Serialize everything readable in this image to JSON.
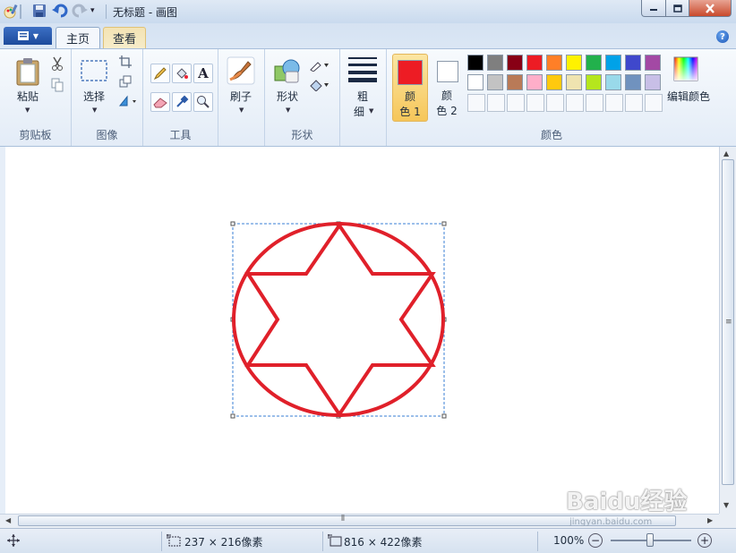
{
  "window": {
    "title": "无标题 - 画图"
  },
  "tabs": {
    "home": "主页",
    "view": "查看"
  },
  "help": "?",
  "clipboard": {
    "paste_label": "粘贴",
    "group_label": "剪贴板"
  },
  "image": {
    "select_label": "选择",
    "group_label": "图像"
  },
  "tools": {
    "text_tool": "A",
    "group_label": "工具"
  },
  "brushes": {
    "label": "刷子"
  },
  "shapes": {
    "label": "形状",
    "group_label": "形状"
  },
  "size": {
    "label_line1": "粗",
    "label_line2": "细"
  },
  "colors": {
    "color1_line1": "颜",
    "color1_line2": "色 1",
    "color2_line1": "颜",
    "color2_line2": "色 2",
    "edit_label": "编辑颜色",
    "group_label": "颜色",
    "color1_value": "#ed1c24",
    "color2_value": "#ffffff",
    "palette_row1": [
      "#000000",
      "#7f7f7f",
      "#880015",
      "#ed1c24",
      "#ff7f27",
      "#fff200",
      "#22b14c",
      "#00a2e8",
      "#3f48cc",
      "#a349a4"
    ],
    "palette_row2": [
      "#ffffff",
      "#c3c3c3",
      "#b97a57",
      "#ffaec9",
      "#ffc90e",
      "#efe4b0",
      "#b5e61d",
      "#99d9ea",
      "#7092be",
      "#c8bfe7"
    ]
  },
  "drawing": {
    "stroke_color": "#e0202a"
  },
  "status": {
    "selection_size": "237 × 216像素",
    "canvas_size": "816 × 422像素",
    "zoom": "100%"
  },
  "watermark": {
    "brand": "Baidu经验",
    "url": "jingyan.baidu.com"
  }
}
